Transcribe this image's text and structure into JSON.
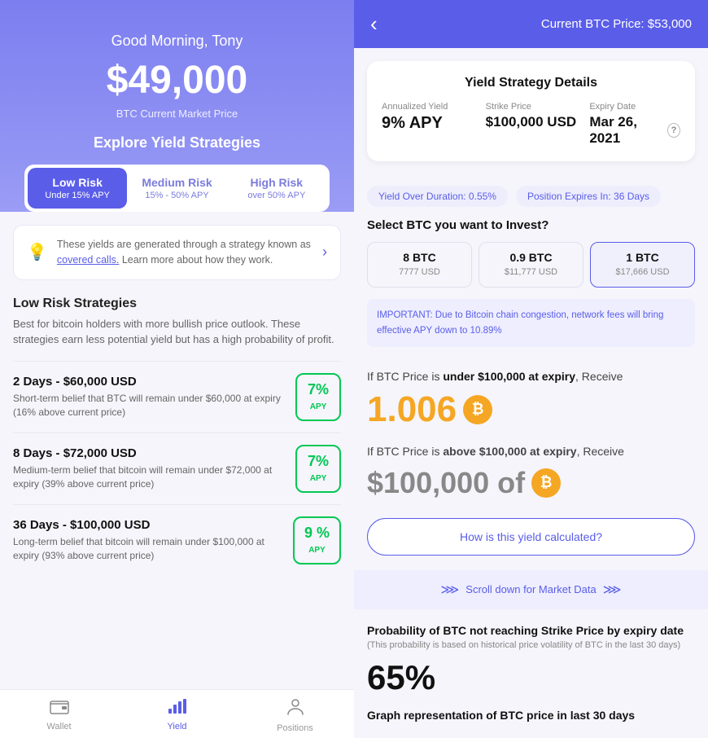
{
  "left": {
    "greeting": "Good Morning, Tony",
    "btc_price": "$49,000",
    "btc_label": "BTC Current Market Price",
    "explore_title": "Explore Yield Strategies",
    "risk_tabs": [
      {
        "name": "Low Risk",
        "sub": "Under 15% APY",
        "active": true
      },
      {
        "name": "Medium Risk",
        "sub": "15% - 50% APY",
        "active": false
      },
      {
        "name": "High Risk",
        "sub": "over 50% APY",
        "active": false
      }
    ],
    "info_text": "These yields are generated through a strategy known as covered calls. Learn more about how they work.",
    "strategies_title": "Low Risk Strategies",
    "strategies_desc": "Best for bitcoin holders with more bullish price outlook. These strategies earn less potential yield but has a high probability of profit.",
    "strategies": [
      {
        "title": "2 Days - $60,000 USD",
        "desc": "Short-term belief that BTC will remain under $60,000 at expiry (16% above current price)",
        "apy": "7%",
        "apy_label": "APY"
      },
      {
        "title": "8 Days - $72,000 USD",
        "desc": "Medium-term belief that bitcoin will remain under $72,000 at expiry (39% above current price)",
        "apy": "7%",
        "apy_label": "APY"
      },
      {
        "title": "36 Days - $100,000 USD",
        "desc": "Long-term belief that bitcoin will remain under $100,000 at expiry (93% above current price)",
        "apy": "9 %",
        "apy_label": "APY"
      }
    ],
    "nav": [
      {
        "label": "Wallet",
        "active": false,
        "icon": "🪙"
      },
      {
        "label": "Yield",
        "active": true,
        "icon": "📊"
      },
      {
        "label": "Positions",
        "active": false,
        "icon": "👤"
      }
    ]
  },
  "right": {
    "header": {
      "back_icon": "‹",
      "current_price_label": "Current BTC Price: $53,000"
    },
    "yield_card": {
      "title": "Yield Strategy Details",
      "metrics": [
        {
          "label": "Annualized Yield",
          "value": "9% APY"
        },
        {
          "label": "Strike Price",
          "value": "$100,000 USD"
        },
        {
          "label": "Expiry Date",
          "value": "Mar 26, 2021"
        }
      ],
      "badges": [
        "Yield Over Duration: 0.55%",
        "Position Expires In: 36 Days"
      ]
    },
    "invest_title": "Select BTC you want to Invest?",
    "btc_options": [
      {
        "amount": "8 BTC",
        "usd": "7777 USD",
        "selected": false
      },
      {
        "amount": "0.9 BTC",
        "usd": "$11,777 USD",
        "selected": false
      },
      {
        "amount": "1 BTC",
        "usd": "$17,666 USD",
        "selected": true
      }
    ],
    "important_text": "IMPORTANT: Due to Bitcoin chain congestion, network fees will bring effective APY down to 10.89%",
    "receive1_prefix": "If BTC Price is ",
    "receive1_condition": "under $100,000 at expiry",
    "receive1_suffix": ", Receive",
    "receive1_amount": "1.006",
    "receive2_prefix": "If BTC Price is ",
    "receive2_condition": "above $100,000 at expiry",
    "receive2_suffix": ", Receive",
    "receive2_amount": "$100,000 of",
    "how_btn": "How is this yield calculated?",
    "scroll_hint": "Scroll down for Market Data",
    "probability_title": "Probability of BTC not reaching Strike Price by expiry date",
    "probability_sub": "(This probability is based on historical price volatility of BTC in the last 30 days)",
    "probability_value": "65%",
    "graph_title": "Graph representation of BTC price in last 30 days"
  }
}
